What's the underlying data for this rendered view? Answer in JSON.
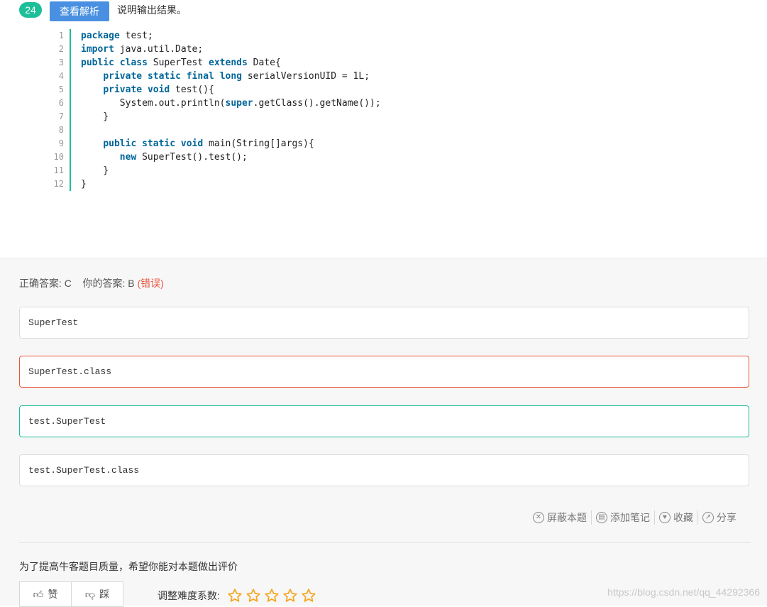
{
  "question": {
    "number": "24",
    "analysis_button": "查看解析",
    "description": "说明输出结果。"
  },
  "code": [
    {
      "n": "1",
      "segs": [
        {
          "t": "package",
          "kw": true
        },
        {
          "t": " test;"
        }
      ]
    },
    {
      "n": "2",
      "segs": [
        {
          "t": "import",
          "kw": true
        },
        {
          "t": " java.util.Date;"
        }
      ]
    },
    {
      "n": "3",
      "segs": [
        {
          "t": "public",
          "kw": true
        },
        {
          "t": " "
        },
        {
          "t": "class",
          "kw": true
        },
        {
          "t": " SuperTest "
        },
        {
          "t": "extends",
          "kw": true
        },
        {
          "t": " Date{"
        }
      ]
    },
    {
      "n": "4",
      "segs": [
        {
          "t": "    "
        },
        {
          "t": "private",
          "kw": true
        },
        {
          "t": " "
        },
        {
          "t": "static",
          "kw": true
        },
        {
          "t": " "
        },
        {
          "t": "final",
          "kw": true
        },
        {
          "t": " "
        },
        {
          "t": "long",
          "kw": true
        },
        {
          "t": " serialVersionUID = 1L;"
        }
      ]
    },
    {
      "n": "5",
      "segs": [
        {
          "t": "    "
        },
        {
          "t": "private",
          "kw": true
        },
        {
          "t": " "
        },
        {
          "t": "void",
          "kw": true
        },
        {
          "t": " test(){"
        }
      ]
    },
    {
      "n": "6",
      "segs": [
        {
          "t": "       System.out.println("
        },
        {
          "t": "super",
          "kw": true
        },
        {
          "t": ".getClass().getName());"
        }
      ]
    },
    {
      "n": "7",
      "segs": [
        {
          "t": "    }"
        }
      ]
    },
    {
      "n": "8",
      "segs": [
        {
          "t": ""
        }
      ]
    },
    {
      "n": "9",
      "segs": [
        {
          "t": "    "
        },
        {
          "t": "public",
          "kw": true
        },
        {
          "t": " "
        },
        {
          "t": "static",
          "kw": true
        },
        {
          "t": " "
        },
        {
          "t": "void",
          "kw": true
        },
        {
          "t": " main(String[]args){"
        }
      ]
    },
    {
      "n": "10",
      "segs": [
        {
          "t": "       "
        },
        {
          "t": "new",
          "kw": true
        },
        {
          "t": " SuperTest().test();"
        }
      ]
    },
    {
      "n": "11",
      "segs": [
        {
          "t": "    }"
        }
      ]
    },
    {
      "n": "12",
      "segs": [
        {
          "t": "}"
        }
      ]
    }
  ],
  "answer": {
    "correct_label": "正确答案: C",
    "yours_label": "你的答案: B",
    "wrong_tag": "(错误)"
  },
  "options": [
    {
      "text": "SuperTest",
      "state": "normal"
    },
    {
      "text": "SuperTest.class",
      "state": "wrong"
    },
    {
      "text": "test.SuperTest",
      "state": "correct"
    },
    {
      "text": "test.SuperTest.class",
      "state": "normal"
    }
  ],
  "actions": {
    "block": "屏蔽本题",
    "note": "添加笔记",
    "favorite": "收藏",
    "share": "分享"
  },
  "feedback": {
    "prompt": "为了提高牛客题目质量，希望你能对本题做出评价",
    "like": "赞",
    "dislike": "踩",
    "difficulty_label": "调整难度系数:",
    "stars_count": 5
  },
  "watermark": "https://blog.csdn.net/qq_44292366",
  "colors": {
    "accent_green": "#1dbf98",
    "button_blue": "#4a90e2",
    "wrong_red": "#e9573f",
    "star_yellow": "#f5a623"
  }
}
